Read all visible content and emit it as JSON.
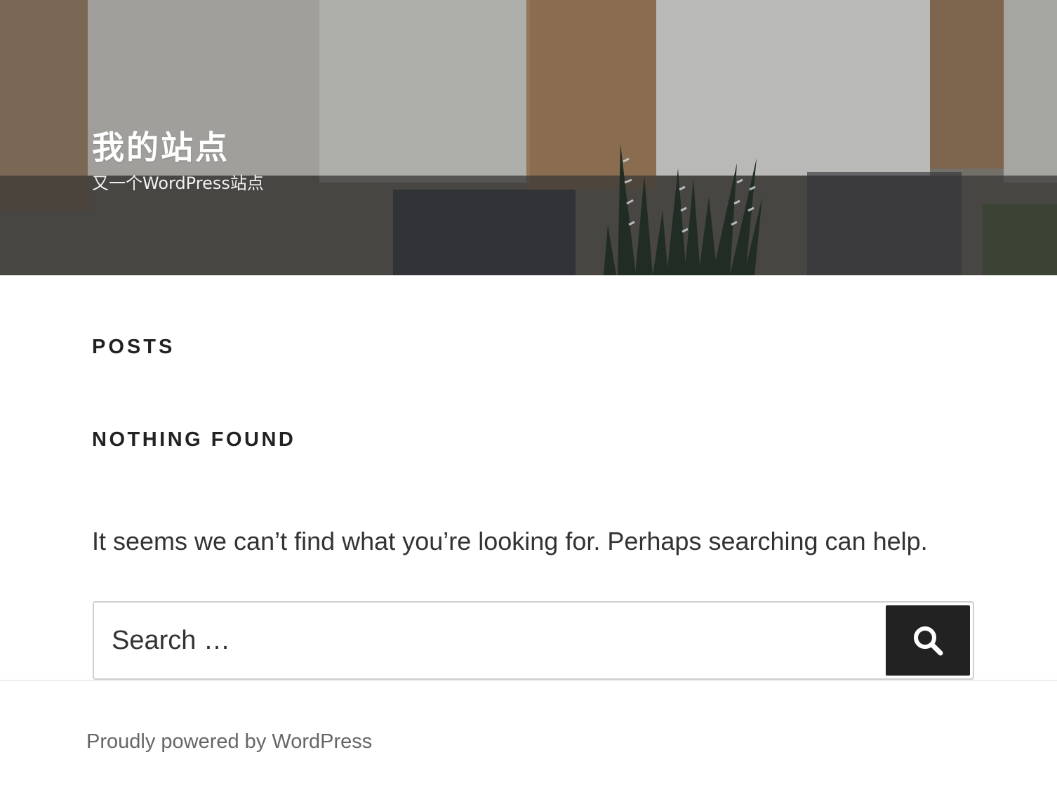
{
  "header": {
    "site_title": "我的站点",
    "site_description": "又一个WordPress站点"
  },
  "main": {
    "page_heading": "POSTS",
    "section_title": "NOTHING FOUND",
    "message": "It seems we can’t find what you’re looking for. Perhaps searching can help.",
    "search": {
      "placeholder": "Search …",
      "button_icon": "search-icon"
    }
  },
  "footer": {
    "credit": "Proudly powered by WordPress"
  },
  "colors": {
    "search_button_bg": "#222222",
    "heading_text": "#222222",
    "footer_text": "#666666"
  }
}
